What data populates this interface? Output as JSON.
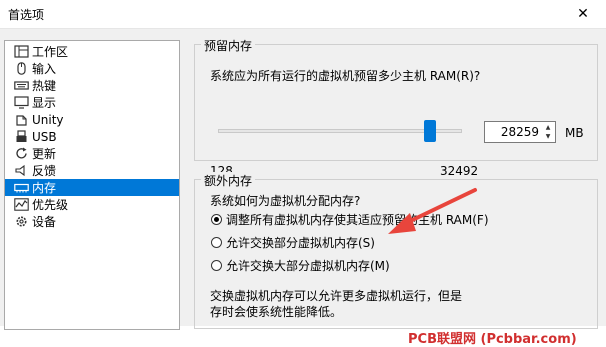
{
  "window": {
    "title": "首选项"
  },
  "sidebar": {
    "items": [
      {
        "label": "工作区",
        "icon": "workspace-icon"
      },
      {
        "label": "输入",
        "icon": "mouse-icon"
      },
      {
        "label": "热键",
        "icon": "keyboard-icon"
      },
      {
        "label": "显示",
        "icon": "monitor-icon"
      },
      {
        "label": "Unity",
        "icon": "unity-icon"
      },
      {
        "label": "USB",
        "icon": "usb-icon"
      },
      {
        "label": "更新",
        "icon": "refresh-icon"
      },
      {
        "label": "反馈",
        "icon": "feedback-icon"
      },
      {
        "label": "内存",
        "icon": "memory-icon",
        "selected": true
      },
      {
        "label": "优先级",
        "icon": "priority-icon"
      },
      {
        "label": "设备",
        "icon": "gear-icon"
      }
    ]
  },
  "reserved_memory": {
    "title": "预留内存",
    "question": "系统应为所有运行的虚拟机预留多少主机 RAM(R)?",
    "value": "28259",
    "unit": "MB",
    "min_label": "128",
    "max_label": "32492"
  },
  "extra_memory": {
    "title": "额外内存",
    "question": "系统如何为虚拟机分配内存?",
    "options": [
      {
        "label": "调整所有虚拟机内存使其适应预留的主机 RAM(F)",
        "checked": true
      },
      {
        "label": "允许交换部分虚拟机内存(S)",
        "checked": false
      },
      {
        "label": "允许交换大部分虚拟机内存(M)",
        "checked": false
      }
    ],
    "note_line1": "交换虚拟机内存可以允许更多虚拟机运行，但是",
    "note_line2": "存时会使系统性能降低。"
  },
  "watermark": {
    "text": "PCB联盟网 (Pcbbar.com)"
  },
  "colors": {
    "accent": "#0078d7",
    "arrow": "#e8453c"
  }
}
